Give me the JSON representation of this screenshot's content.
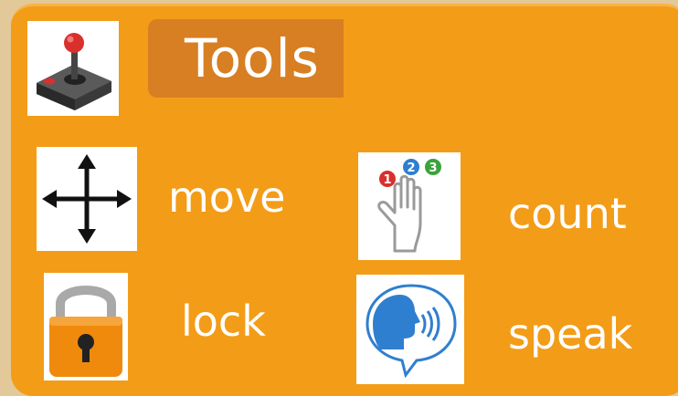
{
  "header": {
    "icon": "joystick-icon",
    "title": "Tools"
  },
  "tools": {
    "move": {
      "label": "move",
      "icon": "move-arrows-icon"
    },
    "count": {
      "label": "count",
      "icon": "count-hand-icon",
      "badges": [
        "1",
        "2",
        "3"
      ]
    },
    "lock": {
      "label": "lock",
      "icon": "padlock-icon"
    },
    "speak": {
      "label": "speak",
      "icon": "speaking-head-icon"
    }
  },
  "colors": {
    "panel": "#f39c17",
    "title_box": "#d77f22",
    "page_background": "#e3c89a",
    "text": "#ffffff"
  }
}
